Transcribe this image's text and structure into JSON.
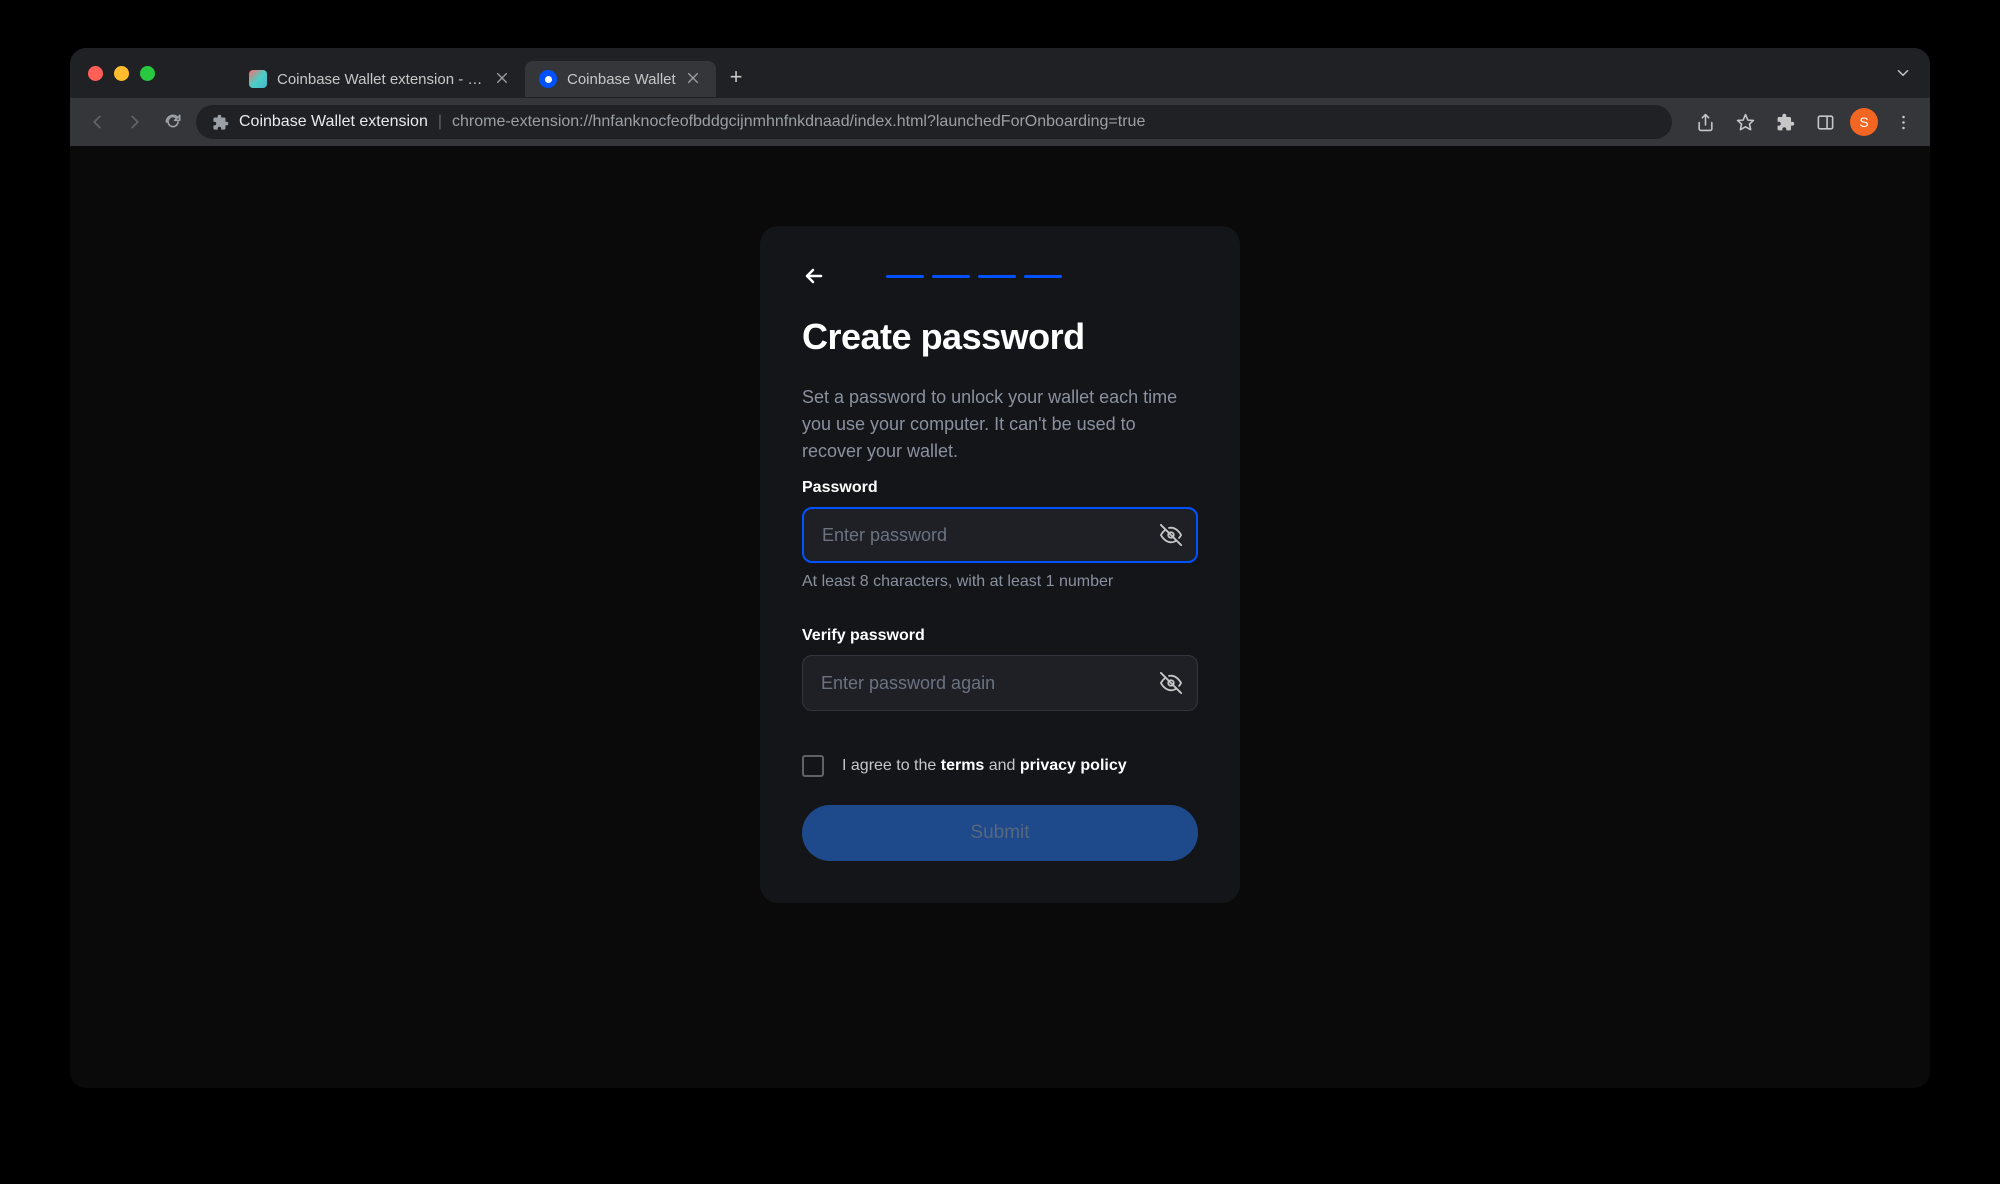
{
  "browser": {
    "tabs": [
      {
        "title": "Coinbase Wallet extension - Ch",
        "active": false
      },
      {
        "title": "Coinbase Wallet",
        "active": true
      }
    ],
    "address": {
      "title": "Coinbase Wallet extension",
      "url": "chrome-extension://hnfanknocfeofbddgcijnmhnfnkdnaad/index.html?launchedForOnboarding=true"
    },
    "avatar_letter": "S"
  },
  "card": {
    "heading": "Create password",
    "description": "Set a password to unlock your wallet each time you use your computer. It can't be used to recover your wallet.",
    "password": {
      "label": "Password",
      "placeholder": "Enter password",
      "hint": "At least 8 characters, with at least 1 number"
    },
    "verify": {
      "label": "Verify password",
      "placeholder": "Enter password again"
    },
    "agree": {
      "prefix": "I agree to the ",
      "terms": "terms",
      "mid": " and ",
      "privacy": "privacy policy"
    },
    "submit_label": "Submit"
  }
}
